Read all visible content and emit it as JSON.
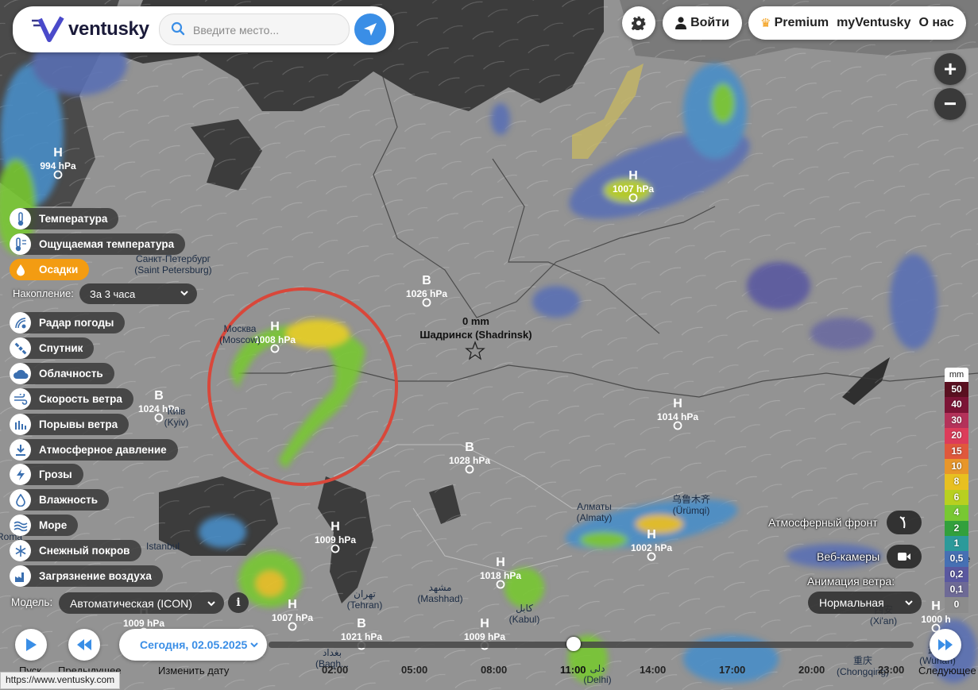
{
  "header": {
    "brand": "ventusky",
    "search_placeholder": "Введите место...",
    "login_label": "Войти",
    "menu": [
      "Premium",
      "myVentusky",
      "О нас"
    ]
  },
  "zoom": {
    "plus": "+",
    "minus": "−"
  },
  "layers": [
    {
      "label": "Температура",
      "icon": "thermometer-icon",
      "active": false
    },
    {
      "label": "Ощущаемая температура",
      "icon": "feels-like-thermometer-icon",
      "active": false
    },
    {
      "label": "Осадки",
      "icon": "droplet-icon",
      "active": true
    },
    {
      "label": "Радар погоды",
      "icon": "radar-icon",
      "active": false
    },
    {
      "label": "Спутник",
      "icon": "satellite-icon",
      "active": false
    },
    {
      "label": "Облачность",
      "icon": "cloud-icon",
      "active": false
    },
    {
      "label": "Скорость ветра",
      "icon": "wind-icon",
      "active": false
    },
    {
      "label": "Порывы ветра",
      "icon": "gusts-icon",
      "active": false
    },
    {
      "label": "Атмосферное давление",
      "icon": "pressure-icon",
      "active": false
    },
    {
      "label": "Грозы",
      "icon": "lightning-icon",
      "active": false
    },
    {
      "label": "Влажность",
      "icon": "humidity-icon",
      "active": false
    },
    {
      "label": "Море",
      "icon": "waves-icon",
      "active": false
    },
    {
      "label": "Снежный покров",
      "icon": "snowflake-icon",
      "active": false
    },
    {
      "label": "Загрязнение воздуха",
      "icon": "factory-icon",
      "active": false
    }
  ],
  "accumulation": {
    "label": "Накопление:",
    "value": "За 3 часа"
  },
  "model": {
    "label": "Модель:",
    "value": "Автоматическая (ICON)",
    "info": "i"
  },
  "right_controls": {
    "front_label": "Атмосферный фронт",
    "webcam_label": "Веб-камеры",
    "wind_anim_label": "Анимация ветра:",
    "wind_anim_value": "Нормальная"
  },
  "legend": {
    "unit": "mm",
    "entries": [
      {
        "v": "50",
        "color": "#5a1020"
      },
      {
        "v": "40",
        "color": "#7c1436"
      },
      {
        "v": "30",
        "color": "#b4325a"
      },
      {
        "v": "20",
        "color": "#dc3c5a"
      },
      {
        "v": "15",
        "color": "#e0583c"
      },
      {
        "v": "10",
        "color": "#e8962a"
      },
      {
        "v": "8",
        "color": "#e8c020"
      },
      {
        "v": "6",
        "color": "#b8d020"
      },
      {
        "v": "4",
        "color": "#78c832"
      },
      {
        "v": "2",
        "color": "#32a03c"
      },
      {
        "v": "1",
        "color": "#2c9a9a"
      },
      {
        "v": "0,5",
        "color": "#4670b4"
      },
      {
        "v": "0,2",
        "color": "#5a58a0"
      },
      {
        "v": "0,1",
        "color": "#6e6a96"
      },
      {
        "v": "0",
        "color": "#8c8c8c"
      }
    ]
  },
  "map": {
    "highlight_color": "#d9473a",
    "pressure_centers": [
      {
        "type": "H",
        "value": "994 hPa"
      },
      {
        "type": "H",
        "value": "1008 hPa"
      },
      {
        "type": "B",
        "value": "1026 hPa"
      },
      {
        "type": "H",
        "value": "1007 hPa"
      },
      {
        "type": "B",
        "value": "1024 hPa"
      },
      {
        "type": "B",
        "value": "1028 hPa"
      },
      {
        "type": "H",
        "value": "1014 hPa"
      },
      {
        "type": "H",
        "value": "1009 hPa"
      },
      {
        "type": "H",
        "value": "1018 hPa"
      },
      {
        "type": "H",
        "value": "1002 hPa"
      },
      {
        "type": "H",
        "value": "1009 hPa"
      },
      {
        "type": "H",
        "value": "1007 hPa"
      },
      {
        "type": "B",
        "value": "1021 hPa"
      },
      {
        "type": "H",
        "value": "1009 hPa"
      },
      {
        "type": "H",
        "value": "1000 h"
      }
    ],
    "cities": [
      {
        "name": "Санкт-Петербург",
        "latin": "(Saint Petersburg)"
      },
      {
        "name": "Москва",
        "latin": "(Moscow)"
      },
      {
        "name": "Киів",
        "latin": "(Kyiv)"
      },
      {
        "name": "Алматы",
        "latin": "(Almaty)"
      },
      {
        "name": "乌鲁木齐",
        "latin": "(Ürümqi)"
      },
      {
        "name": "Istanbul",
        "latin": ""
      },
      {
        "name": "تهران",
        "latin": "(Tehran)"
      },
      {
        "name": "مشهد",
        "latin": "(Mashhad)"
      },
      {
        "name": "کابل",
        "latin": "(Kabul)"
      },
      {
        "name": "دلی",
        "latin": "(Delhi)"
      },
      {
        "name": "西安",
        "latin": "(Xi'an)"
      },
      {
        "name": "重庆",
        "latin": "(Chongqing)"
      },
      {
        "name": "武汉",
        "latin": "(Wuhan)"
      },
      {
        "name": "بغداد",
        "latin": "(Bagh..."
      },
      {
        "name": "",
        "latin": "(Be"
      },
      {
        "name": "Roma",
        "latin": ""
      }
    ],
    "selected_point": {
      "value": "0 mm",
      "name": "Шадринск (Shadrinsk)"
    }
  },
  "playback": {
    "play_label": "Пуск",
    "prev_label": "Предыдущее",
    "date_label": "Сегодня, 02.05.2025",
    "change_date_label": "Изменить дату",
    "next_label": "Следующее",
    "times": [
      "02:00",
      "05:00",
      "08:00",
      "11:00",
      "14:00",
      "17:00",
      "20:00",
      "23:00"
    ],
    "current_time": "11:00"
  },
  "status_bar": {
    "url": "https://www.ventusky.com"
  }
}
